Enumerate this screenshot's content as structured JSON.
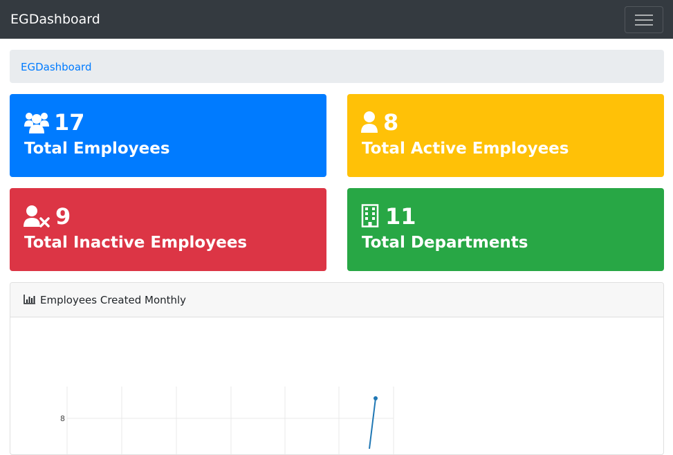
{
  "navbar": {
    "brand": "EGDashboard",
    "toggle_icon": "hamburger-icon"
  },
  "breadcrumb": {
    "items": [
      "EGDashboard"
    ]
  },
  "stats": [
    {
      "value": "17",
      "label": "Total Employees",
      "icon": "users-icon",
      "color": "#007bff"
    },
    {
      "value": "8",
      "label": "Total Active Employees",
      "icon": "user-icon",
      "color": "#ffc107"
    },
    {
      "value": "9",
      "label": "Total Inactive Employees",
      "icon": "user-times-icon",
      "color": "#dc3545"
    },
    {
      "value": "11",
      "label": "Total Departments",
      "icon": "building-icon",
      "color": "#28a745"
    }
  ],
  "chart_panel": {
    "title": "Employees Created Monthly",
    "icon": "bar-chart-icon"
  },
  "chart_data": {
    "type": "line",
    "title": "Employees Created Monthly",
    "xlabel": "",
    "ylabel": "",
    "y_tick_labels": [
      "8"
    ],
    "grid": true,
    "series_color": "#1f77b4",
    "visible_points": [
      {
        "y": 9
      }
    ]
  }
}
